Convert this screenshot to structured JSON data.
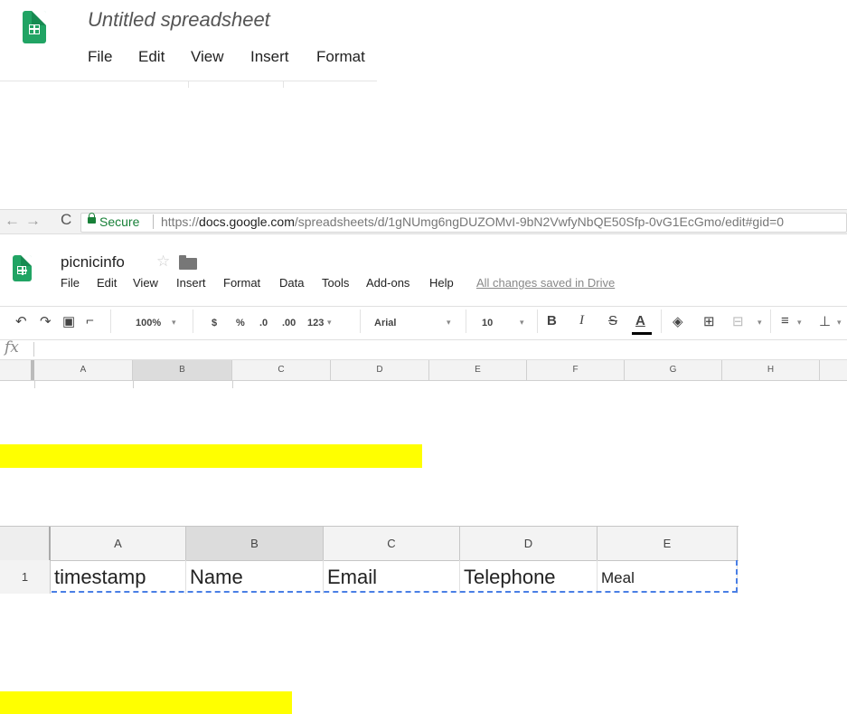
{
  "section1": {
    "title": "Untitled spreadsheet",
    "menu": [
      "File",
      "Edit",
      "View",
      "Insert",
      "Format"
    ]
  },
  "browser": {
    "secure_label": "Secure",
    "url_prefix": "https://",
    "url_domain": "docs.google.com",
    "url_path": "/spreadsheets/d/1gNUmg6ngDUZOMvI-9bN2VwfyNbQE50Sfp-0vG1EcGmo/edit#gid=0"
  },
  "sheet": {
    "title": "picnicinfo",
    "menu": [
      "File",
      "Edit",
      "View",
      "Insert",
      "Format",
      "Data",
      "Tools",
      "Add-ons",
      "Help"
    ],
    "saved_status": "All changes saved in Drive",
    "toolbar": {
      "zoom": "100%",
      "currency": "$",
      "percent": "%",
      "dec_decrease": ".0",
      "dec_increase": ".00",
      "more_formats": "123",
      "font": "Arial",
      "font_size": "10",
      "bold": "B",
      "italic": "I",
      "strike": "S",
      "text_color": "A"
    },
    "fx_label": "fx",
    "columns": [
      "A",
      "B",
      "C",
      "D",
      "E",
      "F",
      "G",
      "H"
    ],
    "selected_column": "B"
  },
  "zoomed_grid": {
    "columns": [
      "A",
      "B",
      "C",
      "D",
      "E"
    ],
    "selected_column": "B",
    "row_number": "1",
    "row": [
      "timestamp",
      "Name",
      "Email",
      "Telephone",
      "Meal"
    ]
  },
  "colors": {
    "highlight": "#ffff00",
    "sheets_green": "#21a464",
    "secure_green": "#188038",
    "selection_dash": "#4a7fe5"
  }
}
